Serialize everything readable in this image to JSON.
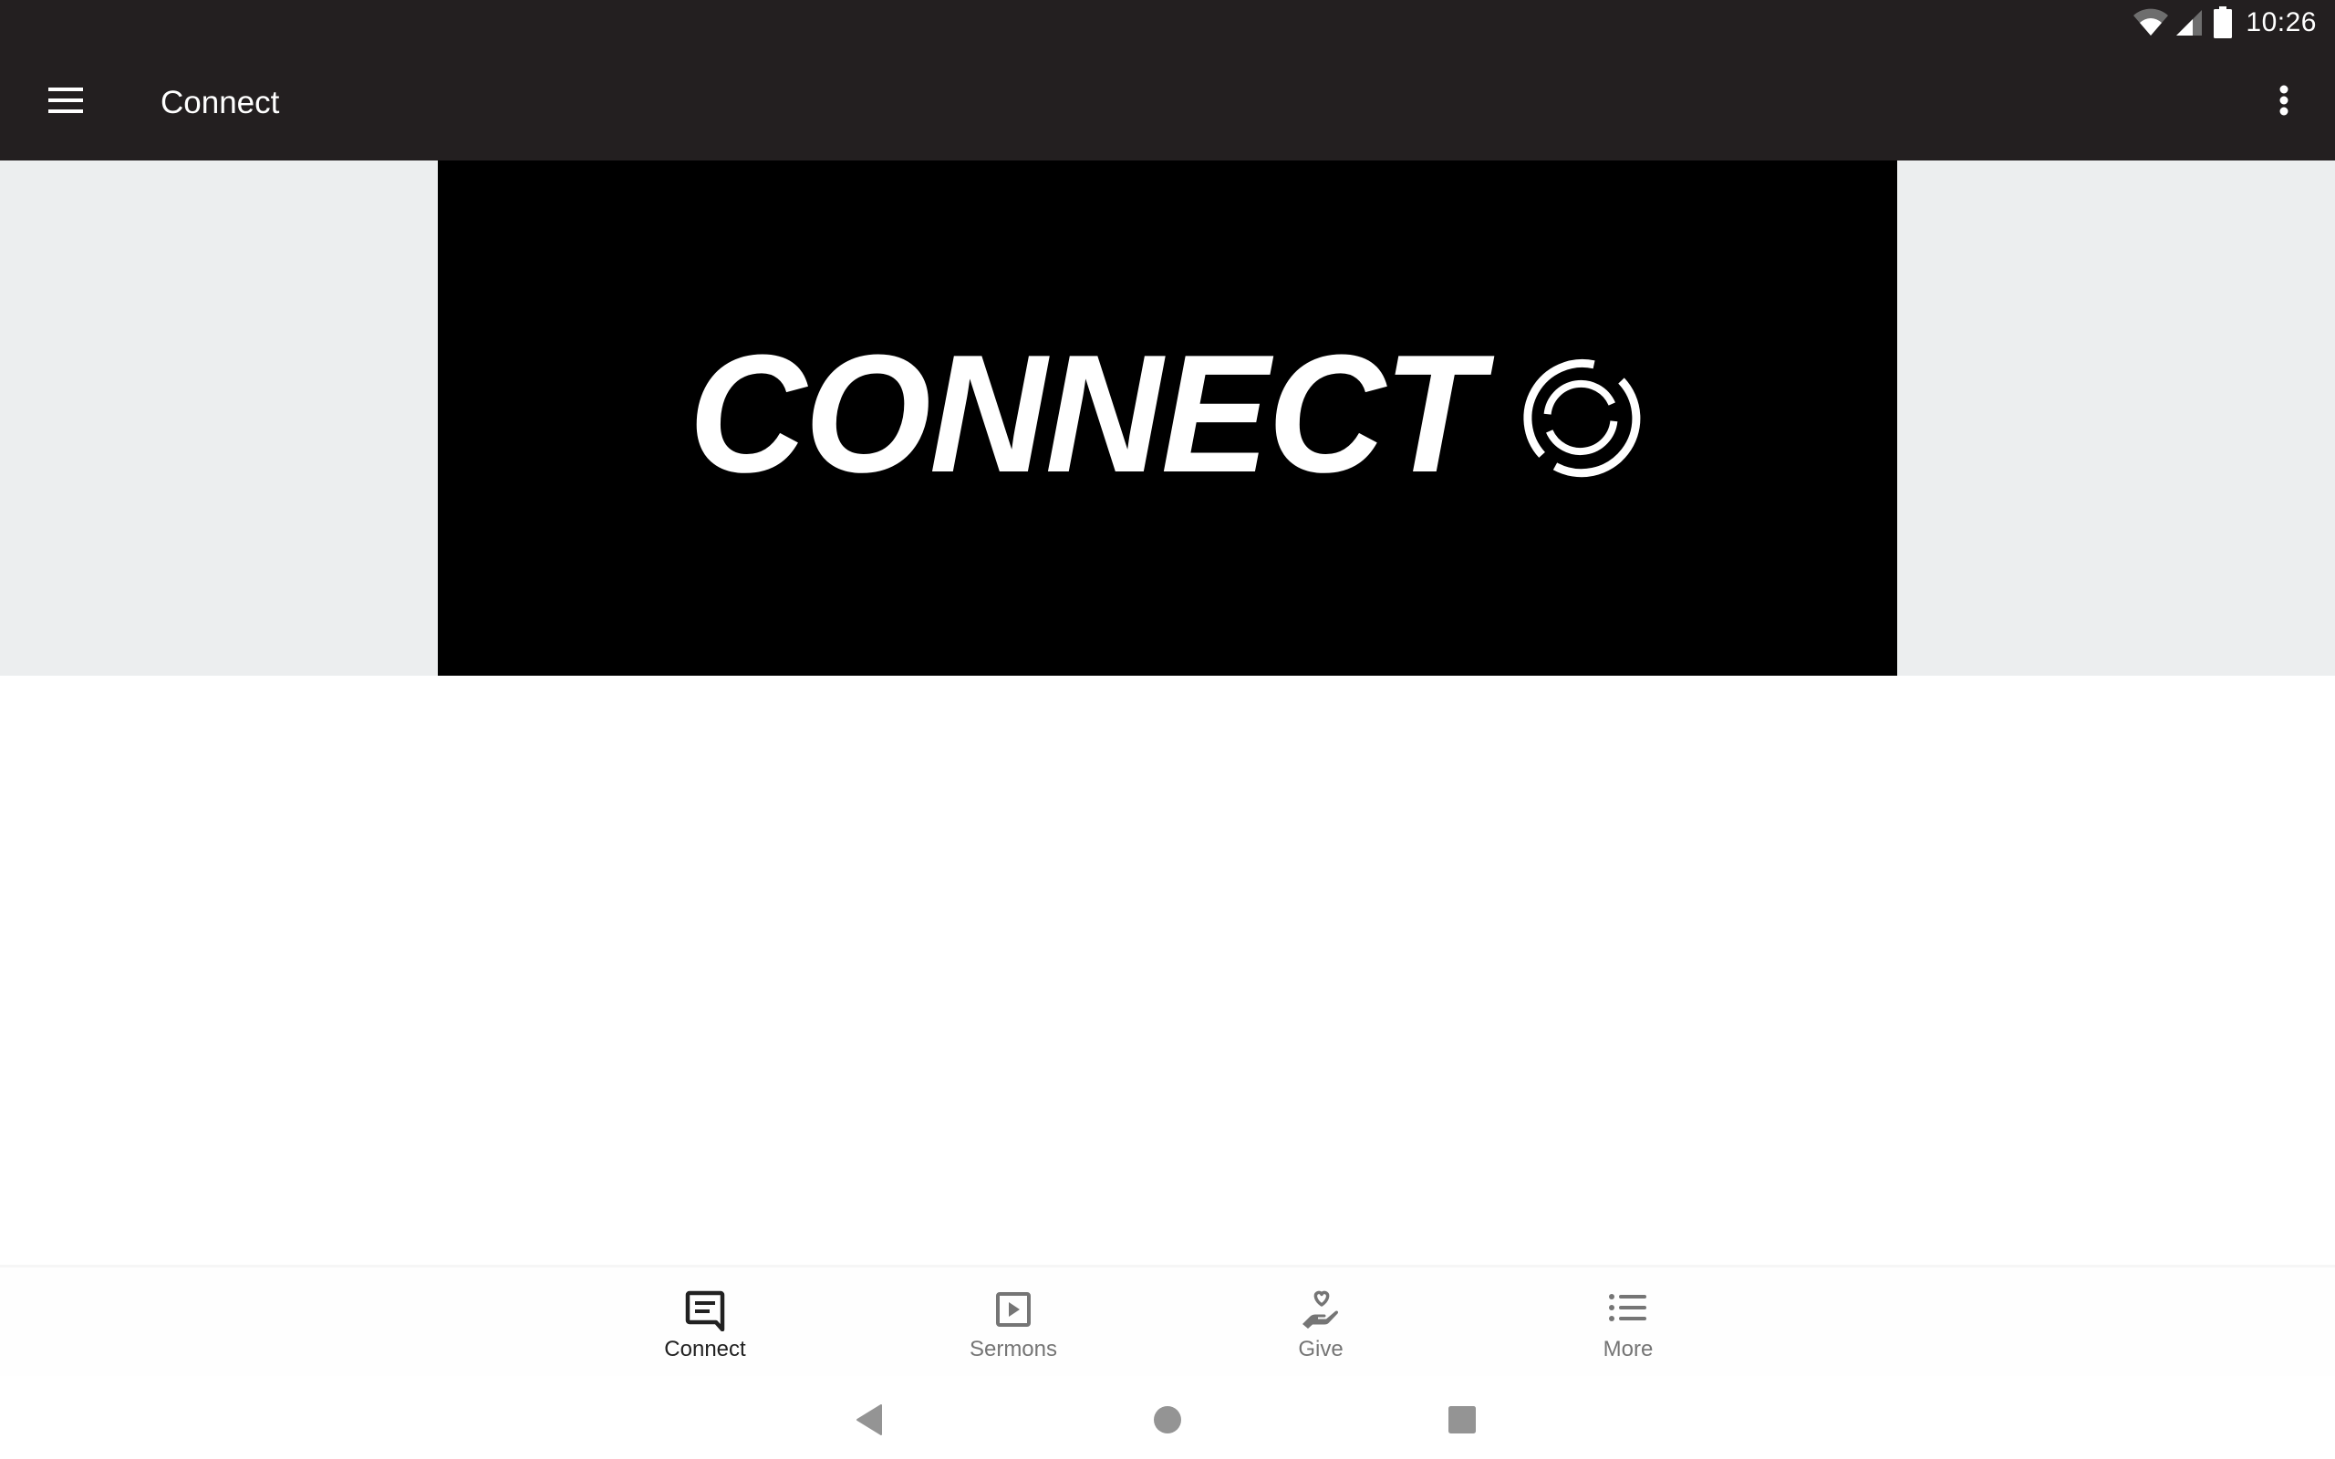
{
  "status_bar": {
    "time": "10:26",
    "icons": [
      "wifi-icon",
      "cellular-signal-icon",
      "battery-icon"
    ]
  },
  "toolbar": {
    "menu_icon": "hamburger-menu-icon",
    "title": "Connect",
    "overflow_icon": "more-vertical-icon"
  },
  "banner": {
    "text": "CONNECT",
    "logo_icon": "concentric-rings-logo-icon",
    "colors": {
      "background": "#000000",
      "foreground": "#ffffff"
    }
  },
  "bottom_nav": {
    "items": [
      {
        "label": "Connect",
        "icon": "chat-message-icon",
        "active": true
      },
      {
        "label": "Sermons",
        "icon": "play-box-icon",
        "active": false
      },
      {
        "label": "Give",
        "icon": "heart-hand-icon",
        "active": false
      },
      {
        "label": "More",
        "icon": "list-icon",
        "active": false
      }
    ],
    "colors": {
      "active": "#212121",
      "inactive": "#757575"
    }
  },
  "system_nav": {
    "buttons": [
      "back",
      "home",
      "recents"
    ]
  },
  "colors": {
    "app_bar": "#231f20",
    "hero_background": "#eceeef",
    "content_background": "#ffffff"
  }
}
